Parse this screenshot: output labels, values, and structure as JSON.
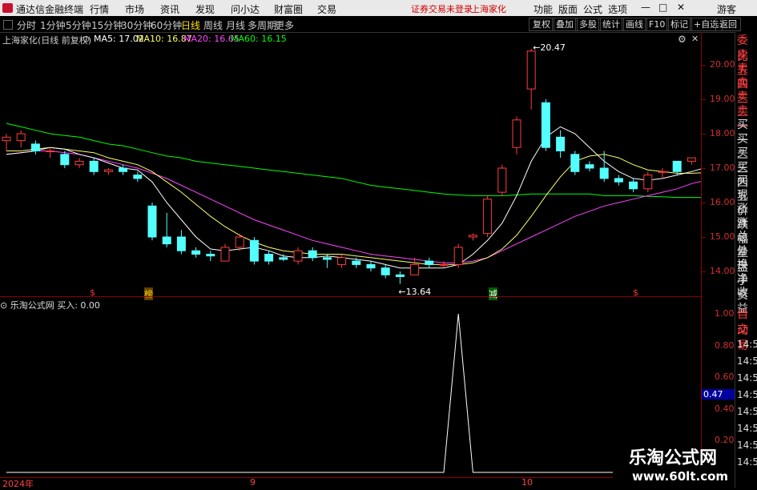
{
  "menu": {
    "app_title": "通达信金融终端",
    "items": [
      "行情",
      "市场",
      "资讯",
      "发现",
      "问小达",
      "财富圈",
      "交易"
    ],
    "login_text": "证券交易未登录",
    "stock_name": "上海家化",
    "tools": [
      "功能",
      "版面",
      "公式",
      "选项"
    ],
    "guest": "游客"
  },
  "periods": {
    "tabs": [
      "分时",
      "1分钟",
      "5分钟",
      "15分钟",
      "30分钟",
      "60分钟",
      "日线",
      "周线",
      "月线",
      "多周期",
      "更多"
    ],
    "active": "日线",
    "right_buttons": [
      "复权",
      "叠加",
      "多股",
      "统计",
      "画线",
      "F10",
      "标记",
      "+自选",
      "返回"
    ]
  },
  "info": {
    "title": "上海家化(日线 前复权)",
    "ma5": "MA5: 17.02",
    "ma10": "MA10: 16.87",
    "ma20": "MA20: 16.65",
    "ma60": "MA60: 16.15",
    "colors": {
      "ma5": "#ffffff",
      "ma10": "#ffff66",
      "ma20": "#ff44ff",
      "ma60": "#00ff00"
    }
  },
  "price_axis": [
    "20.00",
    "19.00",
    "18.00",
    "17.00",
    "16.00",
    "15.00",
    "14.00"
  ],
  "annotations": {
    "high": "20.47",
    "low": "13.64",
    "mark1": "$",
    "mark2": "榜",
    "mark3": "减",
    "mark4": "$"
  },
  "indicator": {
    "title": "乐淘公式网  买入: 0.00",
    "axis": [
      "1.00",
      "0.80",
      "0.60",
      "0.40",
      "0.20"
    ],
    "current": "0.47",
    "signal": "buy spike"
  },
  "dates": [
    "2024年",
    "9",
    "10"
  ],
  "right_panel": {
    "items": [
      "委比",
      "卖五",
      "卖四",
      "卖三",
      "卖二",
      "卖一",
      "买一",
      "买二",
      "买三",
      "买四",
      "买五",
      "现价",
      "涨跌",
      "涨幅",
      "总量",
      "外盘",
      "换手",
      "净资",
      "收益"
    ],
    "lower_items": [
      "自动",
      "交易"
    ],
    "times": [
      "14:56",
      "14:56",
      "14:56",
      "14:56",
      "14:56",
      "14:56",
      "14:56",
      "14:56"
    ]
  },
  "watermark": {
    "line1": "乐淘公式网",
    "line2": "www.60lt.com"
  },
  "chart_data": {
    "type": "candlestick",
    "ylim": [
      13.5,
      20.8
    ],
    "candles": [
      {
        "o": 17.8,
        "c": 17.9,
        "h": 18.0,
        "l": 17.5
      },
      {
        "o": 17.8,
        "c": 18.0,
        "h": 18.1,
        "l": 17.6
      },
      {
        "o": 17.7,
        "c": 17.5,
        "h": 17.8,
        "l": 17.4
      },
      {
        "o": 17.5,
        "c": 17.5,
        "h": 17.6,
        "l": 17.3
      },
      {
        "o": 17.4,
        "c": 17.1,
        "h": 17.5,
        "l": 17.0
      },
      {
        "o": 17.1,
        "c": 17.2,
        "h": 17.3,
        "l": 17.0
      },
      {
        "o": 17.2,
        "c": 16.9,
        "h": 17.3,
        "l": 16.8
      },
      {
        "o": 16.9,
        "c": 16.95,
        "h": 17.0,
        "l": 16.8
      },
      {
        "o": 17.0,
        "c": 16.9,
        "h": 17.1,
        "l": 16.8
      },
      {
        "o": 16.8,
        "c": 16.7,
        "h": 16.9,
        "l": 16.6
      },
      {
        "o": 15.9,
        "c": 15.0,
        "h": 16.0,
        "l": 14.9
      },
      {
        "o": 15.0,
        "c": 14.8,
        "h": 15.7,
        "l": 14.7
      },
      {
        "o": 15.0,
        "c": 14.6,
        "h": 15.2,
        "l": 14.5
      },
      {
        "o": 14.6,
        "c": 14.5,
        "h": 14.7,
        "l": 14.4
      },
      {
        "o": 14.5,
        "c": 14.45,
        "h": 14.6,
        "l": 14.3
      },
      {
        "o": 14.3,
        "c": 14.7,
        "h": 14.8,
        "l": 14.3
      },
      {
        "o": 14.7,
        "c": 15.0,
        "h": 15.1,
        "l": 14.6
      },
      {
        "o": 14.9,
        "c": 14.3,
        "h": 15.0,
        "l": 14.2
      },
      {
        "o": 14.5,
        "c": 14.3,
        "h": 14.6,
        "l": 14.2
      },
      {
        "o": 14.4,
        "c": 14.35,
        "h": 14.5,
        "l": 14.3
      },
      {
        "o": 14.3,
        "c": 14.6,
        "h": 14.7,
        "l": 14.2
      },
      {
        "o": 14.6,
        "c": 14.4,
        "h": 14.7,
        "l": 14.3
      },
      {
        "o": 14.4,
        "c": 14.35,
        "h": 14.5,
        "l": 14.1
      },
      {
        "o": 14.2,
        "c": 14.4,
        "h": 14.5,
        "l": 14.1
      },
      {
        "o": 14.3,
        "c": 14.2,
        "h": 14.4,
        "l": 14.1
      },
      {
        "o": 14.2,
        "c": 14.1,
        "h": 14.3,
        "l": 14.0
      },
      {
        "o": 14.1,
        "c": 13.9,
        "h": 14.2,
        "l": 13.8
      },
      {
        "o": 13.9,
        "c": 13.85,
        "h": 14.0,
        "l": 13.64
      },
      {
        "o": 13.9,
        "c": 14.2,
        "h": 14.4,
        "l": 13.9
      },
      {
        "o": 14.3,
        "c": 14.2,
        "h": 14.4,
        "l": 14.1
      },
      {
        "o": 14.2,
        "c": 14.2,
        "h": 14.3,
        "l": 14.1
      },
      {
        "o": 14.2,
        "c": 14.7,
        "h": 14.8,
        "l": 14.1
      },
      {
        "o": 15.0,
        "c": 15.05,
        "h": 15.1,
        "l": 14.9
      },
      {
        "o": 15.1,
        "c": 16.1,
        "h": 16.2,
        "l": 15.0
      },
      {
        "o": 16.3,
        "c": 17.0,
        "h": 17.1,
        "l": 16.2
      },
      {
        "o": 17.6,
        "c": 18.4,
        "h": 18.5,
        "l": 17.4
      },
      {
        "o": 19.3,
        "c": 20.4,
        "h": 20.47,
        "l": 18.7
      },
      {
        "o": 18.9,
        "c": 17.6,
        "h": 19.0,
        "l": 17.5
      },
      {
        "o": 17.9,
        "c": 17.5,
        "h": 18.1,
        "l": 17.3
      },
      {
        "o": 17.4,
        "c": 16.9,
        "h": 17.5,
        "l": 16.8
      },
      {
        "o": 17.1,
        "c": 17.0,
        "h": 17.2,
        "l": 16.9
      },
      {
        "o": 17.0,
        "c": 16.7,
        "h": 17.5,
        "l": 16.6
      },
      {
        "o": 16.7,
        "c": 16.6,
        "h": 16.8,
        "l": 16.5
      },
      {
        "o": 16.6,
        "c": 16.4,
        "h": 16.7,
        "l": 16.3
      },
      {
        "o": 16.4,
        "c": 16.8,
        "h": 16.9,
        "l": 16.3
      },
      {
        "o": 16.9,
        "c": 16.9,
        "h": 17.0,
        "l": 16.7
      },
      {
        "o": 17.2,
        "c": 16.9,
        "h": 17.2,
        "l": 16.8
      },
      {
        "o": 17.2,
        "c": 17.3,
        "h": 17.3,
        "l": 17.1
      },
      {
        "o": 17.1,
        "c": 17.1,
        "h": 17.2,
        "l": 17.0
      }
    ],
    "ma5": [
      17.4,
      17.45,
      17.5,
      17.6,
      17.55,
      17.4,
      17.3,
      17.15,
      17.0,
      16.95,
      16.6,
      16.0,
      15.5,
      15.0,
      14.65,
      14.6,
      14.65,
      14.7,
      14.6,
      14.45,
      14.4,
      14.4,
      14.45,
      14.4,
      14.35,
      14.3,
      14.2,
      14.1,
      14.1,
      14.1,
      14.1,
      14.2,
      14.5,
      14.9,
      15.4,
      16.2,
      17.2,
      17.9,
      18.2,
      18.0,
      17.6,
      17.2,
      16.9,
      16.7,
      16.65,
      16.7,
      16.8,
      16.9,
      17.02
    ],
    "ma10": [
      17.5,
      17.5,
      17.55,
      17.6,
      17.55,
      17.5,
      17.45,
      17.3,
      17.2,
      17.1,
      16.9,
      16.6,
      16.3,
      15.95,
      15.6,
      15.3,
      15.05,
      14.85,
      14.7,
      14.6,
      14.55,
      14.5,
      14.5,
      14.5,
      14.45,
      14.4,
      14.35,
      14.3,
      14.25,
      14.2,
      14.2,
      14.2,
      14.25,
      14.4,
      14.65,
      15.05,
      15.6,
      16.2,
      16.75,
      17.2,
      17.35,
      17.4,
      17.3,
      17.1,
      16.95,
      16.9,
      16.85,
      16.85,
      16.87
    ],
    "ma20": [
      17.4,
      17.45,
      17.5,
      17.5,
      17.45,
      17.4,
      17.3,
      17.2,
      17.1,
      17.0,
      16.85,
      16.7,
      16.5,
      16.3,
      16.1,
      15.9,
      15.7,
      15.5,
      15.35,
      15.2,
      15.05,
      14.9,
      14.8,
      14.7,
      14.6,
      14.5,
      14.45,
      14.4,
      14.35,
      14.3,
      14.25,
      14.25,
      14.3,
      14.4,
      14.6,
      14.8,
      15.0,
      15.2,
      15.4,
      15.6,
      15.75,
      15.9,
      16.0,
      16.1,
      16.2,
      16.3,
      16.4,
      16.55,
      16.65
    ],
    "ma60": [
      18.3,
      18.2,
      18.1,
      18.0,
      17.95,
      17.9,
      17.8,
      17.7,
      17.65,
      17.55,
      17.45,
      17.35,
      17.3,
      17.2,
      17.15,
      17.1,
      17.05,
      17.0,
      16.95,
      16.9,
      16.85,
      16.8,
      16.75,
      16.7,
      16.6,
      16.5,
      16.45,
      16.4,
      16.35,
      16.3,
      16.25,
      16.22,
      16.2,
      16.2,
      16.2,
      16.22,
      16.25,
      16.25,
      16.25,
      16.25,
      16.25,
      16.2,
      16.2,
      16.2,
      16.18,
      16.17,
      16.15,
      16.15,
      16.15
    ],
    "indicator_values": [
      0,
      0,
      0,
      0,
      0,
      0,
      0,
      0,
      0,
      0,
      0,
      0,
      0,
      0,
      0,
      0,
      0,
      0,
      0,
      0,
      0,
      0,
      0,
      0,
      0,
      0,
      0,
      0,
      0,
      0,
      0,
      1,
      0,
      0,
      0,
      0,
      0,
      0,
      0,
      0,
      0,
      0,
      0,
      0,
      0,
      0,
      0,
      0,
      0
    ]
  }
}
